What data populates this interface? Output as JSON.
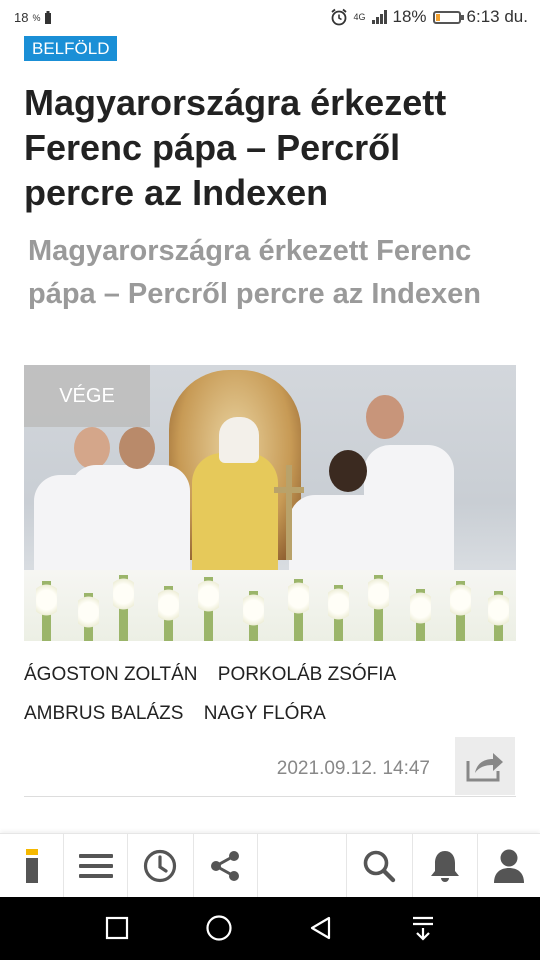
{
  "status_bar": {
    "left_text": "18",
    "battery_text": "18%",
    "time": "6:13 du.",
    "network": "4G",
    "battery_level": 0.18
  },
  "article": {
    "category": "BELFÖLD",
    "title": "Magyarországra érkezett Ferenc pápa – Percről percre az Indexen",
    "subtitle": "Magyarországra érkezett Ferenc pápa – Percről percre az Indexen",
    "photo_badge": "VÉGE",
    "authors": [
      "ÁGOSTON ZOLTÁN",
      "PORKOLÁB ZSÓFIA",
      "AMBRUS BALÁZS",
      "NAGY FLÓRA"
    ],
    "date": "2021.09.12. 14:47"
  },
  "colors": {
    "category_bg": "#1a8fd6",
    "logo_accent": "#f5b800",
    "icon_gray": "#555555"
  },
  "bottom_nav": {
    "items": [
      "index-logo-icon",
      "menu-icon",
      "clock-icon",
      "share-icon",
      "search-icon",
      "bell-icon",
      "user-icon"
    ]
  },
  "system_nav": {
    "items": [
      "recents-icon",
      "home-icon",
      "back-icon",
      "notifications-down-icon"
    ]
  }
}
